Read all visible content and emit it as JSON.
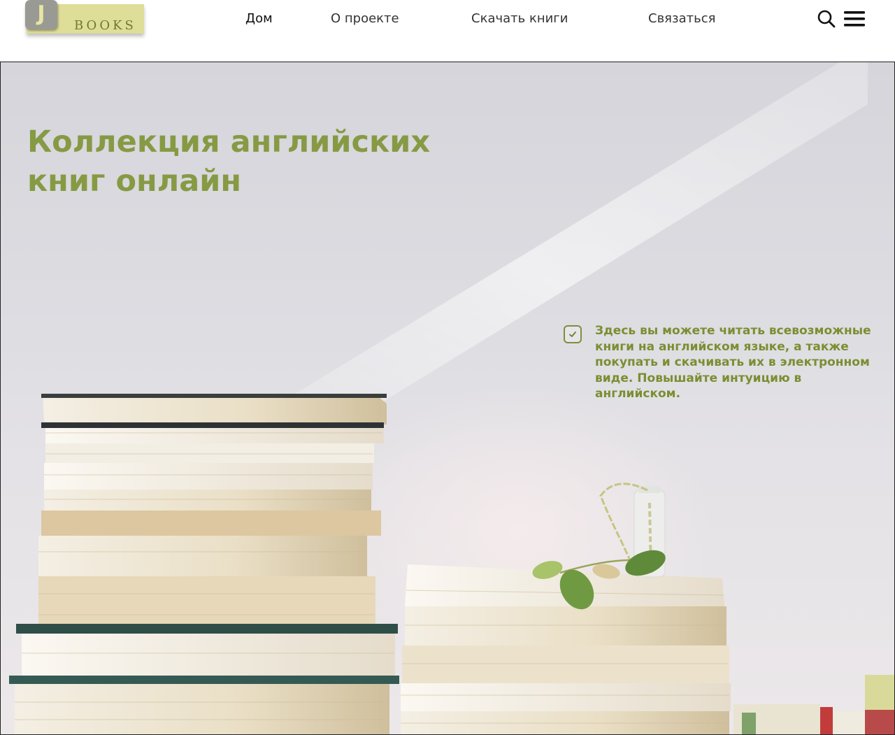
{
  "logo": {
    "letter": "J",
    "word": "BOOKS"
  },
  "nav": {
    "items": [
      {
        "label": "Дом",
        "active": true
      },
      {
        "label": "О проекте"
      },
      {
        "label": "Скачать книги"
      },
      {
        "label": "Связаться"
      }
    ]
  },
  "icons": {
    "search": "search-icon",
    "menu": "hamburger-menu-icon",
    "check": "checkbox-check-icon"
  },
  "hero": {
    "title": "Коллекция английских книг онлайн",
    "feature": {
      "checked": true,
      "text": "Здесь вы можете читать всевозможные книги на английском языке, а также покупать и скачивать их в электронном виде. Повышайте интуицию в английском."
    }
  },
  "colors": {
    "accent_green": "#869a44",
    "logo_yellow": "#dede98",
    "logo_grey": "#9a9a94",
    "nav_text": "#333333",
    "background": "#ffffff"
  }
}
